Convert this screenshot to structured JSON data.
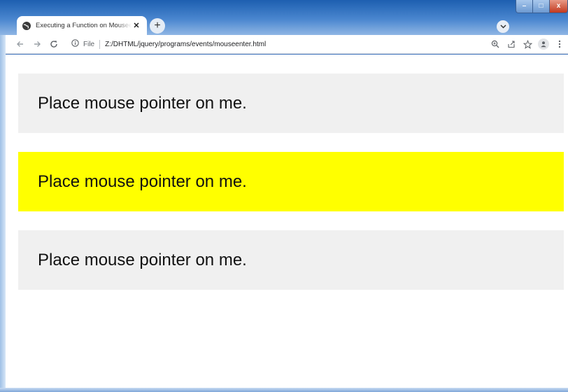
{
  "browser": {
    "tab": {
      "title": "Executing a Function on Mouseenter",
      "close_glyph": "✕"
    },
    "new_tab_glyph": "+",
    "address_bar": {
      "scheme_label": "File",
      "url": "Z:/DHTML/jquery/programs/events/mouseenter.html"
    },
    "window_controls": {
      "minimize": "–",
      "maximize": "□",
      "close": "x"
    },
    "icons": [
      "back-icon",
      "forward-icon",
      "reload-icon",
      "info-icon",
      "zoom-icon",
      "share-icon",
      "star-icon",
      "profile-icon",
      "menu-icon",
      "tab-search-icon"
    ]
  },
  "page": {
    "boxes": [
      {
        "text": "Place mouse pointer on me.",
        "highlighted": false
      },
      {
        "text": "Place mouse pointer on me.",
        "highlighted": true
      },
      {
        "text": "Place mouse pointer on me.",
        "highlighted": false
      }
    ],
    "colors": {
      "box_default": "#f0f0f0",
      "box_hover": "#ffff00"
    }
  }
}
